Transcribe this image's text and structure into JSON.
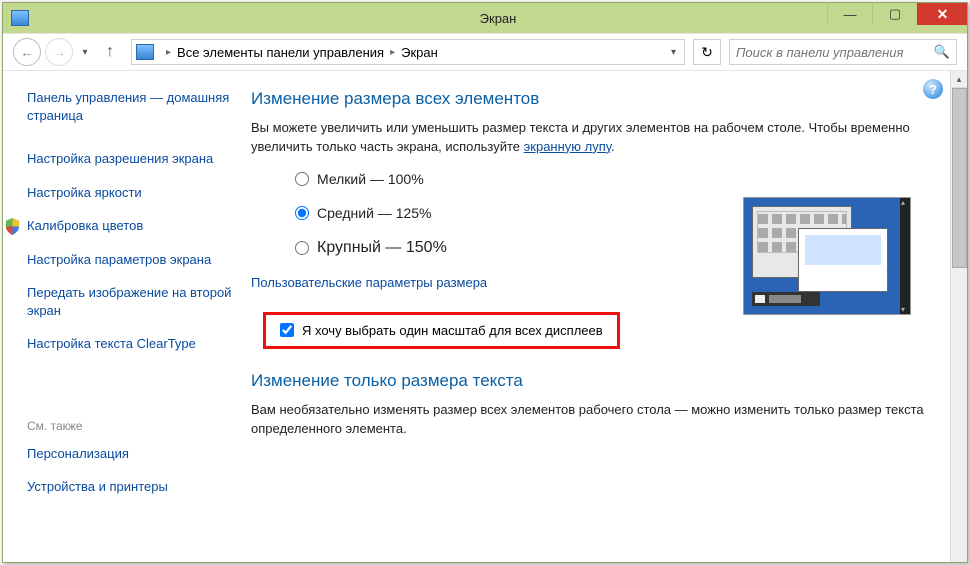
{
  "window": {
    "title": "Экран"
  },
  "breadcrumb": {
    "item1": "Все элементы панели управления",
    "item2": "Экран"
  },
  "search": {
    "placeholder": "Поиск в панели управления"
  },
  "sidebar": {
    "home": "Панель управления — домашняя страница",
    "items": [
      "Настройка разрешения экрана",
      "Настройка яркости",
      "Калибровка цветов",
      "Настройка параметров экрана",
      "Передать изображение на второй экран",
      "Настройка текста ClearType"
    ],
    "seeAlsoLabel": "См. также",
    "seeAlso": [
      "Персонализация",
      "Устройства и принтеры"
    ]
  },
  "main": {
    "heading1": "Изменение размера всех элементов",
    "intro_before": "Вы можете увеличить или уменьшить размер текста и других элементов на рабочем столе. Чтобы временно увеличить только часть экрана, используйте ",
    "intro_link": "экранную лупу",
    "intro_after": ".",
    "radio": [
      "Мелкий — 100%",
      "Средний — 125%",
      "Крупный — 150%"
    ],
    "customLink": "Пользовательские параметры размера",
    "checkboxLabel": "Я хочу выбрать один масштаб для всех дисплеев",
    "heading2": "Изменение только размера текста",
    "body2": "Вам необязательно изменять размер всех элементов рабочего стола — можно изменить только размер текста определенного элемента."
  }
}
